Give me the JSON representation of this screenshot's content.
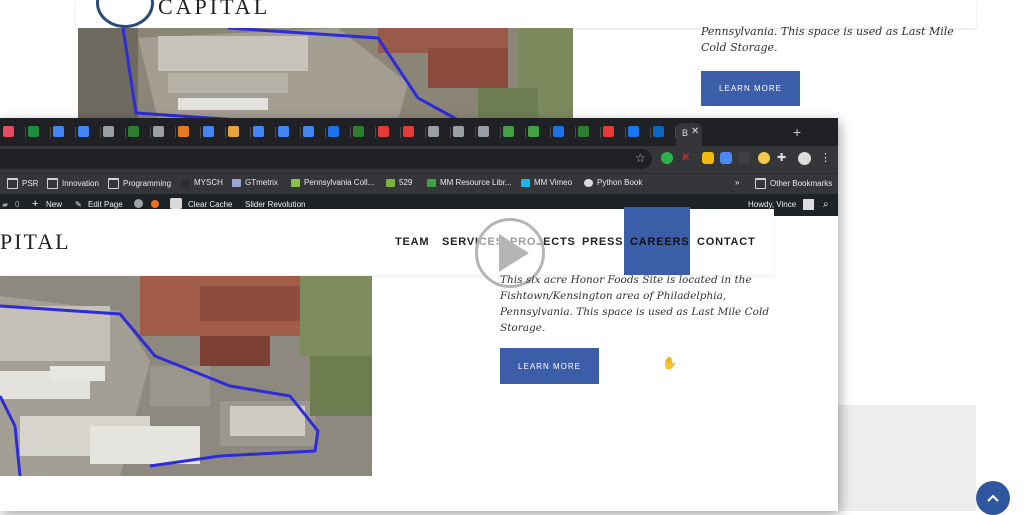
{
  "background": {
    "logo_text": "CAPITAL",
    "description": "Pennsylvania. This space is used as Last Mile Cold Storage.",
    "learn_more_label": "LEARN MORE",
    "scroll_top_icon": "chevron-up-icon"
  },
  "browser": {
    "active_tab_label": "B",
    "active_tab_close": "✕",
    "new_tab_label": "+",
    "tab_favicon_colors": [
      "#e84a5f",
      "#1e8e3e",
      "#4285f4",
      "#4285f4",
      "#9aa0a6",
      "#2e7d32",
      "#9aa0a6",
      "#e67c22",
      "#4285f4",
      "#e8a33d",
      "#4285f4",
      "#4285f4",
      "#4285f4",
      "#1a73e8",
      "#2e7d32",
      "#e53935",
      "#e53935",
      "#9aa0a6",
      "#9aa0a6",
      "#9aa0a6",
      "#43a047",
      "#43a047",
      "#1a73e8",
      "#2e7d32",
      "#e53935",
      "#1877f2",
      "#0a66c2"
    ],
    "bookmarks": [
      {
        "label": "PSR",
        "icon": "folder-icon"
      },
      {
        "label": "Innovation",
        "icon": "folder-icon"
      },
      {
        "label": "Programming",
        "icon": "folder-icon"
      },
      {
        "label": "MYSCH",
        "icon": "site-icon"
      },
      {
        "label": "GTmetrix",
        "icon": "monitor-icon"
      },
      {
        "label": "Pennsylvania Coll...",
        "icon": "site-icon"
      },
      {
        "label": "529",
        "icon": "site-icon"
      },
      {
        "label": "MM Resource Libr...",
        "icon": "arrow-icon"
      },
      {
        "label": "MM Vimeo",
        "icon": "vimeo-icon"
      },
      {
        "label": "Python Book",
        "icon": "globe-icon"
      }
    ],
    "bookmarks_more": "»",
    "other_bookmarks": "Other Bookmarks"
  },
  "wp_admin_bar": {
    "comments_count": "0",
    "new_label": "New",
    "edit_page_label": "Edit Page",
    "clear_cache_label": "Clear Cache",
    "slider_revolution_label": "Slider Revolution",
    "howdy_label": "Howdy, Vince"
  },
  "site": {
    "logo_text": "PITAL",
    "nav": {
      "team": "TEAM",
      "services": "SERVICES",
      "projects": "PROJECTS",
      "press": "PRESS",
      "careers": "CAREERS",
      "contact": "CONTACT"
    },
    "description": "This six acre Honor Foods Site is located in the Fishtown/Kensington area of Philadelphia, Pennsylvania. This space is used as Last Mile Cold Storage.",
    "learn_more_label": "LEARN MORE",
    "cursor_glyph": "✋"
  },
  "colors": {
    "accent": "#3c5ea8",
    "tab_bar": "#202124",
    "toolbar": "#35363a",
    "wp_bar": "#1d2327"
  }
}
